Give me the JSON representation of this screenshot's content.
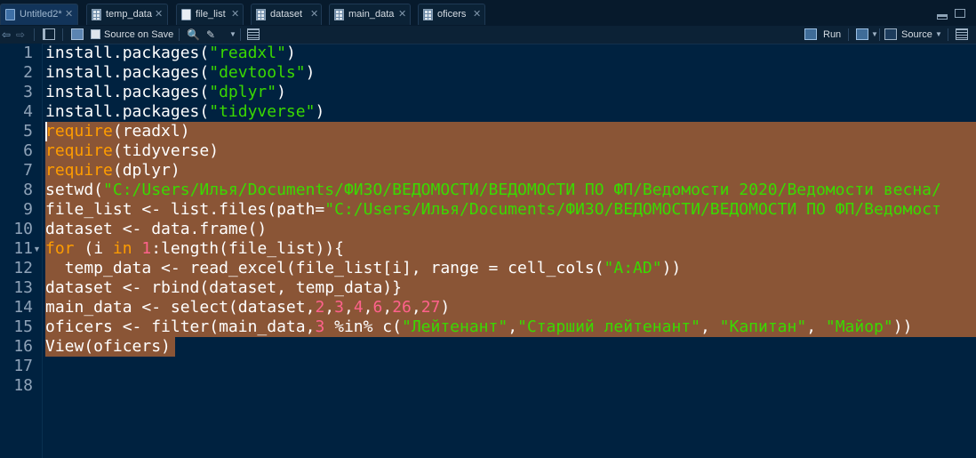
{
  "tabs": [
    {
      "label": "Untitled2*",
      "icon": "r-script-icon",
      "active": true
    },
    {
      "label": "temp_data",
      "icon": "data-table-icon",
      "active": false
    },
    {
      "label": "file_list",
      "icon": "document-icon",
      "active": false
    },
    {
      "label": "dataset",
      "icon": "data-table-icon",
      "active": false
    },
    {
      "label": "main_data",
      "icon": "data-table-icon",
      "active": false
    },
    {
      "label": "oficers",
      "icon": "data-table-icon",
      "active": false
    }
  ],
  "tab_close_glyph": "✕",
  "toolbar": {
    "source_on_save_label": "Source on Save",
    "run_label": "Run",
    "source_label": "Source"
  },
  "editor": {
    "line_numbers": [
      "1",
      "2",
      "3",
      "4",
      "5",
      "6",
      "7",
      "8",
      "9",
      "10",
      "11",
      "12",
      "13",
      "14",
      "15",
      "16",
      "17",
      "18"
    ],
    "selected_lines": [
      "5",
      "16"
    ],
    "colors": {
      "background": "#002240",
      "selection": "#8a5536",
      "string": "#3ad900",
      "keyword": "#ff9d00",
      "number": "#ff628c"
    }
  },
  "code": {
    "l1": [
      "install.packages(",
      "\"readxl\"",
      ")"
    ],
    "l2": [
      "install.packages(",
      "\"devtools\"",
      ")"
    ],
    "l3": [
      "install.packages(",
      "\"dplyr\"",
      ")"
    ],
    "l4": [
      "install.packages(",
      "\"tidyverse\"",
      ")"
    ],
    "l5": [
      "require",
      "(readxl)"
    ],
    "l6": [
      "require",
      "(tidyverse)"
    ],
    "l7": [
      "require",
      "(dplyr)"
    ],
    "l8": [
      "setwd(",
      "\"C:/Users/Илья/Documents/ФИЗО/ВЕДОМОСТИ/ВЕДОМОСТИ ПО ФП/Ведомости 2020/Ведомости весна/"
    ],
    "l9": [
      "file_list <- list.files(path=",
      "\"C:/Users/Илья/Documents/ФИЗО/ВЕДОМОСТИ/ВЕДОМОСТИ ПО ФП/Ведомост"
    ],
    "l10": [
      "dataset <- data.frame()"
    ],
    "l11": [
      "for",
      " (i ",
      "in",
      " ",
      "1",
      ":length(file_list)){"
    ],
    "l12": [
      "  temp_data <- read_excel(file_list[i], range = cell_cols(",
      "\"A:AD\"",
      "))"
    ],
    "l13": [
      "dataset <- rbind(dataset, temp_data)}"
    ],
    "l14": [
      "main_data <- select(dataset,",
      "2",
      ",",
      "3",
      ",",
      "4",
      ",",
      "6",
      ",",
      "26",
      ",",
      "27",
      ")"
    ],
    "l15": [
      "oficers <- filter(main_data,",
      "3",
      " %in% c(",
      "\"Лейтенант\"",
      ",",
      "\"Старший лейтенант\"",
      ", ",
      "\"Капитан\"",
      ", ",
      "\"Майор\"",
      "))"
    ],
    "l16": [
      "View(oficers)"
    ]
  }
}
